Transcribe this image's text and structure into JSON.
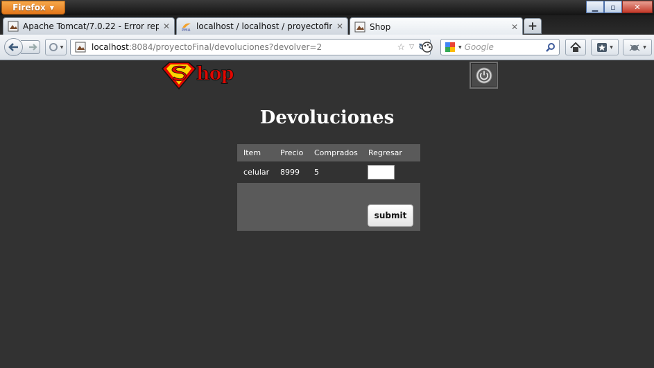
{
  "window": {
    "firefox_button": "Firefox"
  },
  "tabs": [
    {
      "label": "Apache Tomcat/7.0.22 - Error report",
      "icon": "generic-page-icon"
    },
    {
      "label": "localhost / localhost / proyectofinal / ...",
      "icon": "phpmyadmin-icon"
    },
    {
      "label": "Shop",
      "icon": "generic-page-icon"
    }
  ],
  "navbar": {
    "url_host": "localhost",
    "url_rest": ":8084/proyectoFinal/devoluciones?devolver=2",
    "search_placeholder": "Google"
  },
  "page": {
    "logo_text": "hop",
    "title": "Devoluciones",
    "table": {
      "headers": [
        "Item",
        "Precio",
        "Comprados",
        "Regresar"
      ],
      "rows": [
        {
          "item": "celular",
          "precio": "8999",
          "comprados": "5",
          "regresar": ""
        }
      ]
    },
    "submit_label": "submit"
  },
  "colors": {
    "page_bg": "#323232",
    "table_header_bg": "#5a5a5a",
    "firefox_orange": "#e2761a",
    "logo_red": "#e10600",
    "logo_yellow": "#ffd400"
  }
}
